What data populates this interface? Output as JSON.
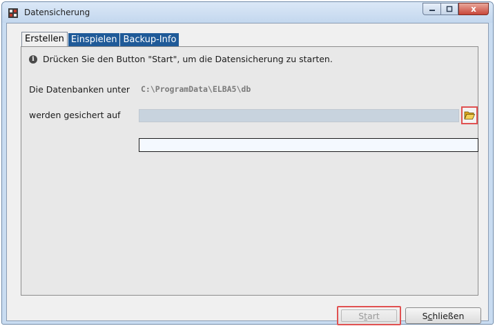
{
  "window": {
    "title": "Datensicherung",
    "controls": {
      "minimize": "–",
      "maximize": "□",
      "close": "x"
    }
  },
  "tabs": [
    {
      "label": "Erstellen",
      "active": true
    },
    {
      "label": "Einspielen",
      "active": false
    },
    {
      "label": "Backup-Info",
      "active": false
    }
  ],
  "panel": {
    "info_text": "Drücken Sie den Button \"Start\", um die Datensicherung zu starten.",
    "source_label": "Die Datenbanken unter",
    "source_path": "C:\\ProgramData\\ELBA5\\db",
    "target_label": "werden gesichert auf",
    "target_value": "",
    "progress_value": ""
  },
  "buttons": {
    "start": {
      "label": "Start",
      "mnemonic_pre": "S",
      "mnemonic_char": "t",
      "mnemonic_post": "art",
      "enabled": false
    },
    "close": {
      "pre": "S",
      "char": "c",
      "post": "hließen"
    }
  },
  "colors": {
    "tab_inactive": "#1f5a98",
    "highlight": "#e05050"
  },
  "icons": {
    "app": "app-icon",
    "info": "info-icon",
    "browse": "folder-open-icon"
  }
}
